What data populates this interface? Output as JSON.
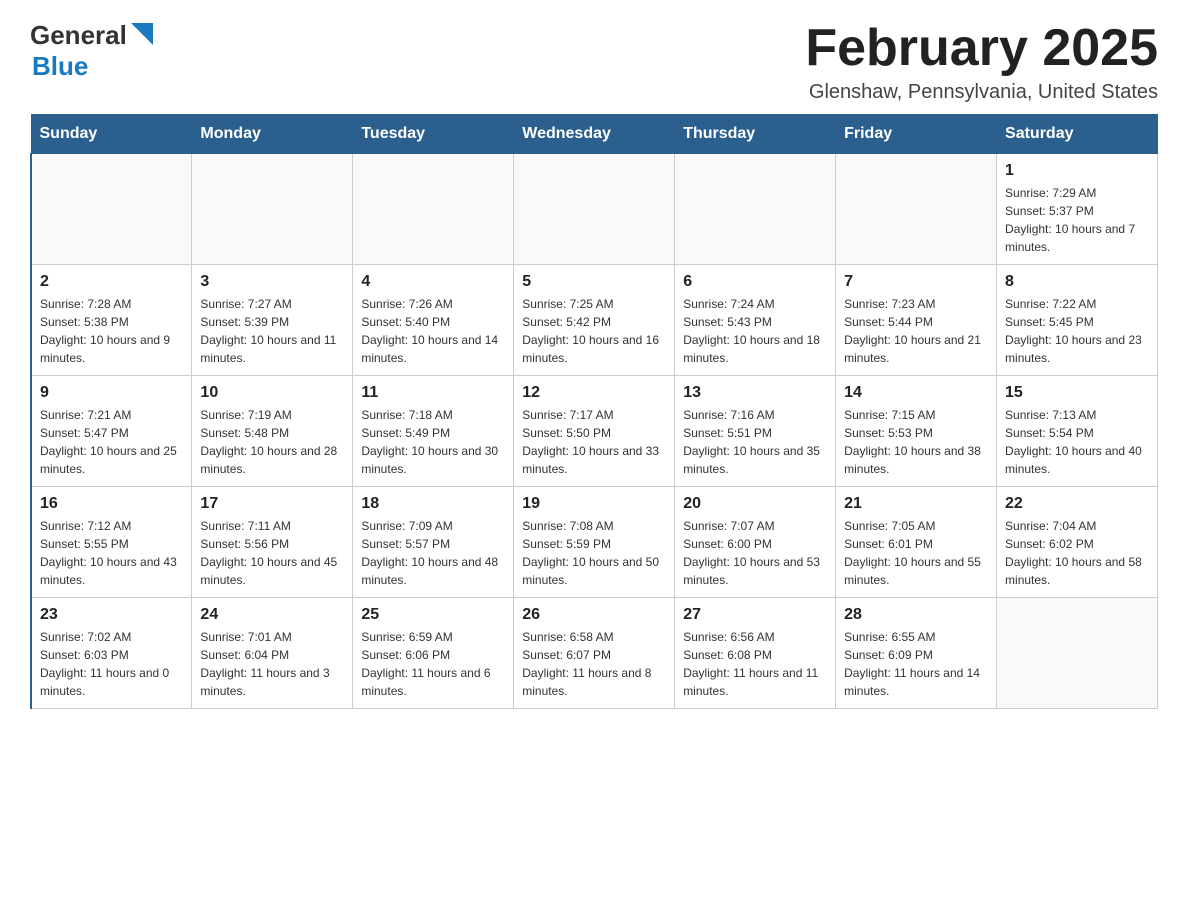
{
  "header": {
    "logo_line1": "General",
    "logo_line2": "Blue",
    "month_title": "February 2025",
    "location": "Glenshaw, Pennsylvania, United States"
  },
  "weekdays": [
    "Sunday",
    "Monday",
    "Tuesday",
    "Wednesday",
    "Thursday",
    "Friday",
    "Saturday"
  ],
  "weeks": [
    [
      {
        "day": "",
        "info": ""
      },
      {
        "day": "",
        "info": ""
      },
      {
        "day": "",
        "info": ""
      },
      {
        "day": "",
        "info": ""
      },
      {
        "day": "",
        "info": ""
      },
      {
        "day": "",
        "info": ""
      },
      {
        "day": "1",
        "info": "Sunrise: 7:29 AM\nSunset: 5:37 PM\nDaylight: 10 hours and 7 minutes."
      }
    ],
    [
      {
        "day": "2",
        "info": "Sunrise: 7:28 AM\nSunset: 5:38 PM\nDaylight: 10 hours and 9 minutes."
      },
      {
        "day": "3",
        "info": "Sunrise: 7:27 AM\nSunset: 5:39 PM\nDaylight: 10 hours and 11 minutes."
      },
      {
        "day": "4",
        "info": "Sunrise: 7:26 AM\nSunset: 5:40 PM\nDaylight: 10 hours and 14 minutes."
      },
      {
        "day": "5",
        "info": "Sunrise: 7:25 AM\nSunset: 5:42 PM\nDaylight: 10 hours and 16 minutes."
      },
      {
        "day": "6",
        "info": "Sunrise: 7:24 AM\nSunset: 5:43 PM\nDaylight: 10 hours and 18 minutes."
      },
      {
        "day": "7",
        "info": "Sunrise: 7:23 AM\nSunset: 5:44 PM\nDaylight: 10 hours and 21 minutes."
      },
      {
        "day": "8",
        "info": "Sunrise: 7:22 AM\nSunset: 5:45 PM\nDaylight: 10 hours and 23 minutes."
      }
    ],
    [
      {
        "day": "9",
        "info": "Sunrise: 7:21 AM\nSunset: 5:47 PM\nDaylight: 10 hours and 25 minutes."
      },
      {
        "day": "10",
        "info": "Sunrise: 7:19 AM\nSunset: 5:48 PM\nDaylight: 10 hours and 28 minutes."
      },
      {
        "day": "11",
        "info": "Sunrise: 7:18 AM\nSunset: 5:49 PM\nDaylight: 10 hours and 30 minutes."
      },
      {
        "day": "12",
        "info": "Sunrise: 7:17 AM\nSunset: 5:50 PM\nDaylight: 10 hours and 33 minutes."
      },
      {
        "day": "13",
        "info": "Sunrise: 7:16 AM\nSunset: 5:51 PM\nDaylight: 10 hours and 35 minutes."
      },
      {
        "day": "14",
        "info": "Sunrise: 7:15 AM\nSunset: 5:53 PM\nDaylight: 10 hours and 38 minutes."
      },
      {
        "day": "15",
        "info": "Sunrise: 7:13 AM\nSunset: 5:54 PM\nDaylight: 10 hours and 40 minutes."
      }
    ],
    [
      {
        "day": "16",
        "info": "Sunrise: 7:12 AM\nSunset: 5:55 PM\nDaylight: 10 hours and 43 minutes."
      },
      {
        "day": "17",
        "info": "Sunrise: 7:11 AM\nSunset: 5:56 PM\nDaylight: 10 hours and 45 minutes."
      },
      {
        "day": "18",
        "info": "Sunrise: 7:09 AM\nSunset: 5:57 PM\nDaylight: 10 hours and 48 minutes."
      },
      {
        "day": "19",
        "info": "Sunrise: 7:08 AM\nSunset: 5:59 PM\nDaylight: 10 hours and 50 minutes."
      },
      {
        "day": "20",
        "info": "Sunrise: 7:07 AM\nSunset: 6:00 PM\nDaylight: 10 hours and 53 minutes."
      },
      {
        "day": "21",
        "info": "Sunrise: 7:05 AM\nSunset: 6:01 PM\nDaylight: 10 hours and 55 minutes."
      },
      {
        "day": "22",
        "info": "Sunrise: 7:04 AM\nSunset: 6:02 PM\nDaylight: 10 hours and 58 minutes."
      }
    ],
    [
      {
        "day": "23",
        "info": "Sunrise: 7:02 AM\nSunset: 6:03 PM\nDaylight: 11 hours and 0 minutes."
      },
      {
        "day": "24",
        "info": "Sunrise: 7:01 AM\nSunset: 6:04 PM\nDaylight: 11 hours and 3 minutes."
      },
      {
        "day": "25",
        "info": "Sunrise: 6:59 AM\nSunset: 6:06 PM\nDaylight: 11 hours and 6 minutes."
      },
      {
        "day": "26",
        "info": "Sunrise: 6:58 AM\nSunset: 6:07 PM\nDaylight: 11 hours and 8 minutes."
      },
      {
        "day": "27",
        "info": "Sunrise: 6:56 AM\nSunset: 6:08 PM\nDaylight: 11 hours and 11 minutes."
      },
      {
        "day": "28",
        "info": "Sunrise: 6:55 AM\nSunset: 6:09 PM\nDaylight: 11 hours and 14 minutes."
      },
      {
        "day": "",
        "info": ""
      }
    ]
  ]
}
